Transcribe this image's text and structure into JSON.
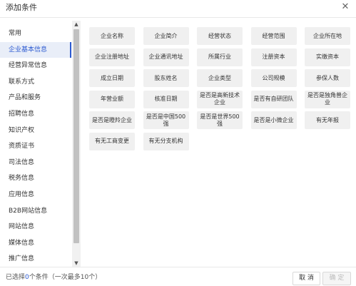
{
  "dialog": {
    "title": "添加条件",
    "close_glyph": "✕"
  },
  "sidebar": {
    "items": [
      {
        "label": "常用",
        "active": false
      },
      {
        "label": "企业基本信息",
        "active": true
      },
      {
        "label": "经营异常信息",
        "active": false
      },
      {
        "label": "联系方式",
        "active": false
      },
      {
        "label": "产品和服务",
        "active": false
      },
      {
        "label": "招聘信息",
        "active": false
      },
      {
        "label": "知识产权",
        "active": false
      },
      {
        "label": "资质证书",
        "active": false
      },
      {
        "label": "司法信息",
        "active": false
      },
      {
        "label": "税务信息",
        "active": false
      },
      {
        "label": "应用信息",
        "active": false
      },
      {
        "label": "B2B网站信息",
        "active": false
      },
      {
        "label": "网站信息",
        "active": false
      },
      {
        "label": "媒体信息",
        "active": false
      },
      {
        "label": "推广信息",
        "active": false
      }
    ],
    "scroll_up_glyph": "▲",
    "scroll_down_glyph": "▼"
  },
  "conditions": {
    "tags": [
      "企业名称",
      "企业简介",
      "经营状态",
      "经营范围",
      "企业所在地",
      "企业注册地址",
      "企业通讯地址",
      "所属行业",
      "注册资本",
      "实缴资本",
      "成立日期",
      "股东姓名",
      "企业类型",
      "公司规模",
      "参保人数",
      "年营业额",
      "核准日期",
      "是否是高新技术企业",
      "是否有自研团队",
      "是否是独角兽企业",
      "是否是瞪羚企业",
      "是否是中国500强",
      "是否是世界500强",
      "是否是小微企业",
      "有无年报",
      "有无工商变更",
      "有无分支机构"
    ]
  },
  "footer": {
    "status_prefix": "已选择",
    "selected_count": "0",
    "status_suffix": "个条件（一次最多10个）",
    "cancel_label": "取 消",
    "confirm_label": "确 定"
  }
}
